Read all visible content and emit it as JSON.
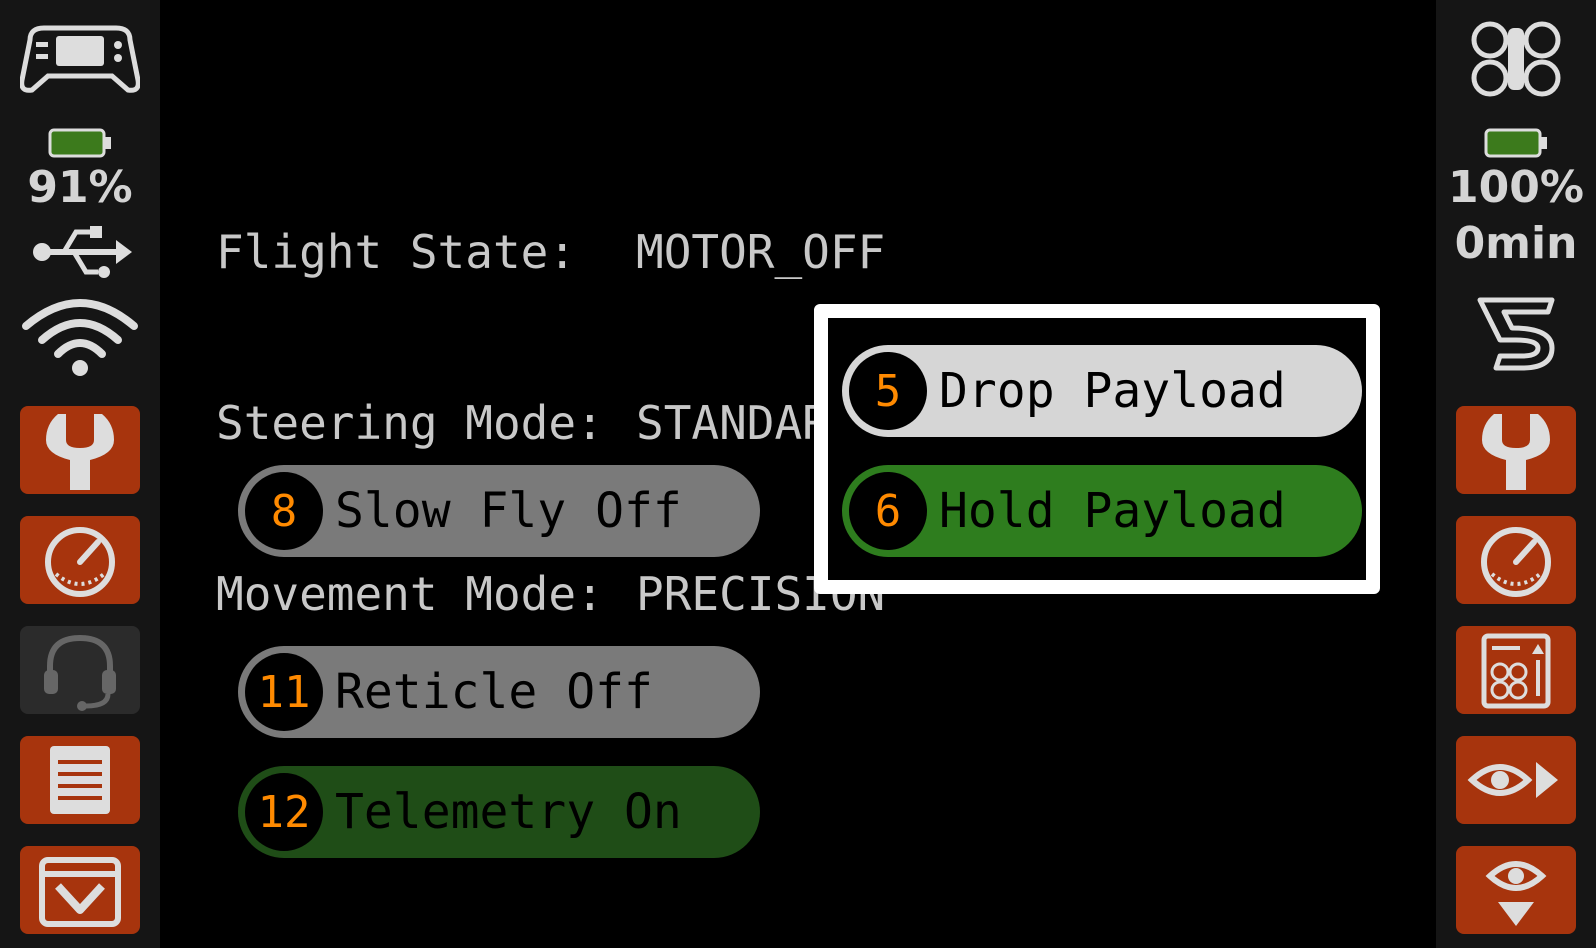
{
  "left_sidebar": {
    "battery_percent": "91%",
    "battery_level": 0.91,
    "icons": [
      "controller-icon",
      "usb-icon",
      "wifi-icon",
      "wrench-icon",
      "gauge-icon",
      "headset-icon",
      "document-icon",
      "dropdown-icon"
    ]
  },
  "right_sidebar": {
    "battery_percent": "100%",
    "flight_time": "0min",
    "battery_level": 1.0,
    "icons": [
      "drone-icon",
      "brand-s-icon",
      "wrench-icon",
      "gauge-icon",
      "drone-info-icon",
      "eye-forward-icon",
      "eye-down-icon"
    ]
  },
  "status": {
    "flight_state_label": "Flight State:",
    "flight_state_value": "MOTOR_OFF",
    "steering_mode_label": "Steering Mode:",
    "steering_mode_value": "STANDARD",
    "movement_mode_label": "Movement Mode:",
    "movement_mode_value": "PRECISION"
  },
  "buttons": {
    "drop_payload": {
      "number": "5",
      "label": "Drop Payload"
    },
    "hold_payload": {
      "number": "6",
      "label": "Hold Payload"
    },
    "slow_fly": {
      "number": "8",
      "label": "Slow Fly Off"
    },
    "reticle": {
      "number": "11",
      "label": "Reticle Off"
    },
    "telemetry": {
      "number": "12",
      "label": "Telemetry On"
    }
  },
  "colors": {
    "accent_orange": "#a7340d",
    "number_orange": "#ff8a00",
    "active_green": "#2e7d1e",
    "battery_green": "#3c7a1c"
  }
}
